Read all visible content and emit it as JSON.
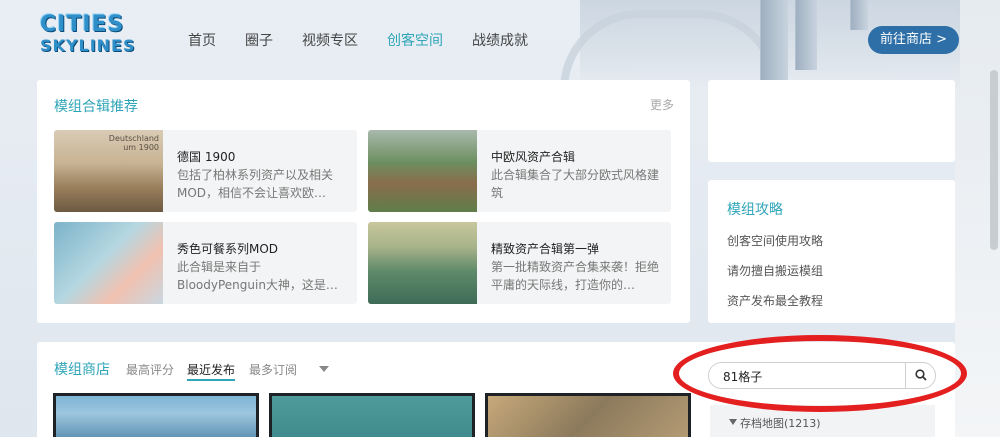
{
  "header": {
    "logo_line1": "CITIES",
    "logo_line2": "SKYLINES",
    "nav": [
      {
        "label": "首页"
      },
      {
        "label": "圈子"
      },
      {
        "label": "视频专区"
      },
      {
        "label": "创客空间",
        "active": true
      },
      {
        "label": "战绩成就"
      }
    ],
    "shop_button": "前往商店 >"
  },
  "recommend": {
    "title": "模组合辑推荐",
    "more": "更多",
    "cards": [
      {
        "title": "德国 1900",
        "desc": "包括了柏林系列资产以及相关MOD，相信不会让喜欢欧…",
        "thumb_caption_1": "Deutschland",
        "thumb_caption_2": "um 1900"
      },
      {
        "title": "中欧风资产合辑",
        "desc": "此合辑集合了大部分欧式风格建筑"
      },
      {
        "title": "秀色可餐系列MOD",
        "desc": "此合辑是来自于BloodyPenguin大神，这是…"
      },
      {
        "title": "精致资产合辑第一弹",
        "desc": "第一批精致资产合集来袭！拒绝平庸的天际线，打造你的…"
      }
    ]
  },
  "guide": {
    "title": "模组攻略",
    "links": [
      "创客空间使用攻略",
      "请勿擅自搬运模组",
      "资产发布最全教程"
    ]
  },
  "store": {
    "title": "模组商店",
    "tabs": [
      {
        "label": "最高评分"
      },
      {
        "label": "最近发布",
        "active": true
      },
      {
        "label": "最多订阅"
      }
    ],
    "search": {
      "value": "81格子"
    },
    "archive_label": "存档地图(1213)"
  },
  "colors": {
    "accent": "#2fa5b8",
    "shop_button": "#2e6fa8",
    "annotation_red": "#e41f1f"
  }
}
